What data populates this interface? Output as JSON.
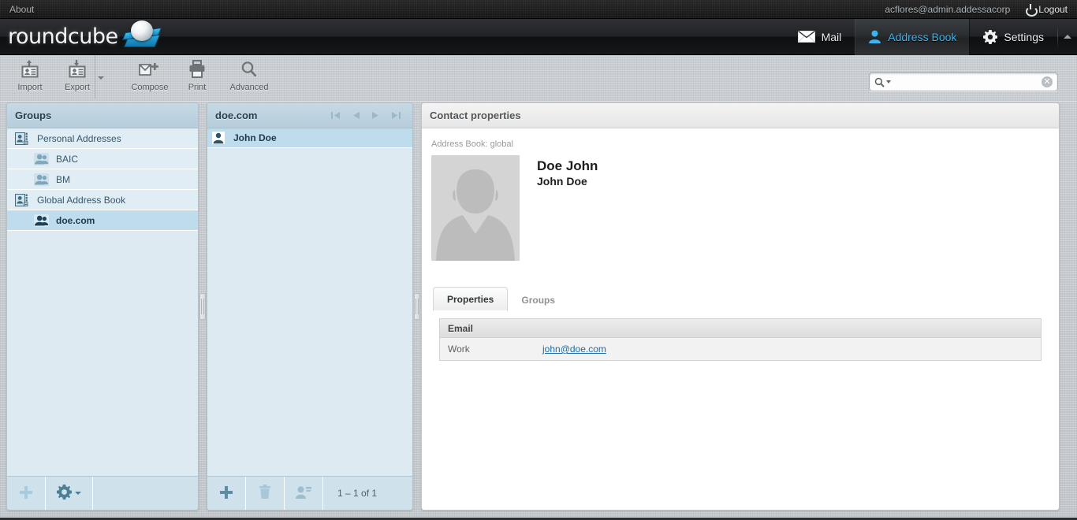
{
  "topbar": {
    "about_label": "About",
    "username": "acflores@admin.addessacorp",
    "logout_label": "Logout",
    "power_icon": "power-icon"
  },
  "header": {
    "logo_text": "roundcube",
    "tasks": [
      {
        "label": "Mail",
        "icon": "envelope-icon",
        "selected": false
      },
      {
        "label": "Address Book",
        "icon": "person-icon",
        "selected": true
      },
      {
        "label": "Settings",
        "icon": "gear-icon",
        "selected": false
      }
    ],
    "collapse_icon": "chevron-up-icon"
  },
  "toolbar": {
    "buttons": [
      {
        "label": "Import",
        "icon": "import-contacts-icon",
        "has_arrow": false
      },
      {
        "label": "Export",
        "icon": "export-contacts-icon",
        "has_arrow": true
      },
      {
        "label": "Compose",
        "icon": "compose-icon",
        "has_arrow": false
      },
      {
        "label": "Print",
        "icon": "printer-icon",
        "has_arrow": false
      },
      {
        "label": "Advanced",
        "icon": "magnifier-icon",
        "has_arrow": false
      }
    ]
  },
  "search": {
    "value": "",
    "placeholder": "",
    "icon": "search-icon",
    "dropdown_icon": "chevron-down-icon",
    "clear_icon": "clear-circle-icon",
    "clear_glyph": "✕"
  },
  "groups_panel": {
    "title": "Groups",
    "rows": [
      {
        "label": "Personal Addresses",
        "type": "book",
        "icon": "addressbook-icon",
        "selected": false
      },
      {
        "label": "BAIC",
        "type": "group",
        "icon": "contactgroup-icon",
        "selected": false
      },
      {
        "label": "BM",
        "type": "group",
        "icon": "contactgroup-icon",
        "selected": false
      },
      {
        "label": "Global Address Book",
        "type": "book",
        "icon": "addressbook-icon",
        "selected": false
      },
      {
        "label": "doe.com",
        "type": "group",
        "icon": "contactgroup-icon",
        "selected": true
      }
    ],
    "footer": {
      "add_icon": "plus-icon",
      "options_icon": "gear-icon",
      "options_arrow_icon": "chevron-down-icon"
    }
  },
  "list_panel": {
    "title": "doe.com",
    "pager": {
      "first_icon": "page-first-icon",
      "prev_icon": "page-prev-icon",
      "next_icon": "page-next-icon",
      "last_icon": "page-last-icon"
    },
    "contacts": [
      {
        "label": "John Doe",
        "icon": "contact-icon",
        "selected": true
      }
    ],
    "footer": {
      "add_icon": "plus-icon",
      "delete_icon": "trash-icon",
      "remove_from_group_icon": "remove-contact-icon",
      "count_text": "1 – 1 of 1"
    }
  },
  "contact_panel": {
    "title": "Contact properties",
    "address_book_line": "Address Book: global",
    "photo_icon": "contact-photo-placeholder",
    "display_name": "Doe John",
    "full_name": "John Doe",
    "tabs": [
      {
        "label": "Properties",
        "active": true
      },
      {
        "label": "Groups",
        "active": false
      }
    ],
    "fieldsets": [
      {
        "legend": "Email",
        "rows": [
          {
            "label": "Work",
            "value": "john@doe.com",
            "is_link": true
          }
        ]
      }
    ]
  },
  "colors": {
    "accent_blue": "#3db4ef",
    "panel_blue": "#ddeaf1",
    "selected_blue": "#bfdced",
    "link_blue": "#1b6ea8",
    "header_dark": "#1b1b1b"
  }
}
